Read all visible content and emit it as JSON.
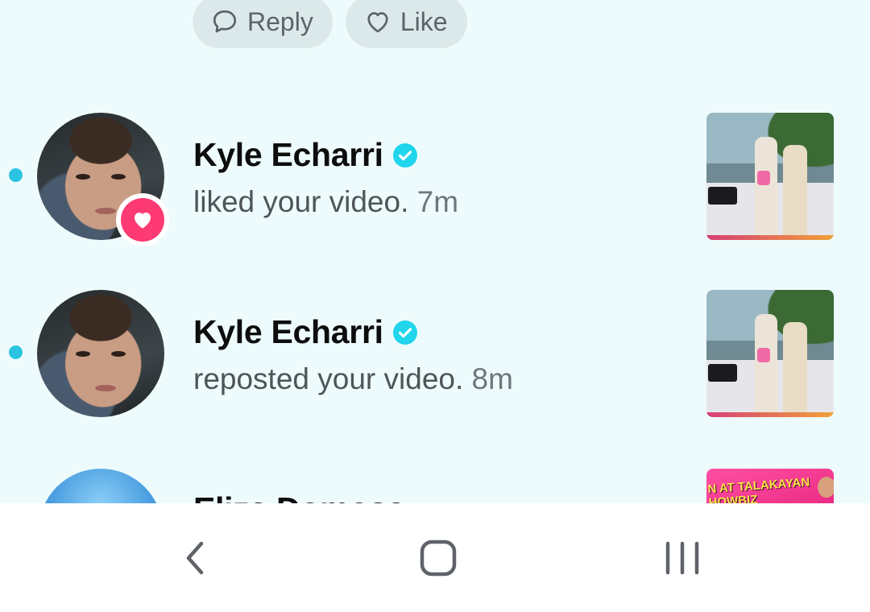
{
  "top_actions": {
    "reply_label": "Reply",
    "like_label": "Like"
  },
  "notifications": [
    {
      "name": "Kyle Echarri",
      "verified": true,
      "action": "liked your video.",
      "time": "7m",
      "unread": true,
      "badge_icon": "heart-icon"
    },
    {
      "name": "Kyle Echarri",
      "verified": true,
      "action": "reposted your video.",
      "time": "8m",
      "unread": true
    },
    {
      "name": "Eliza Domosa",
      "thumbnail_text": "N AT TALAKAYAN HOWBIZ"
    }
  ],
  "nav": {
    "back_icon": "chevron-left-icon",
    "home_icon": "rounded-square-icon",
    "recents_icon": "three-bars-icon"
  },
  "colors": {
    "background": "#eefbfc",
    "unread_dot": "#2cc3e3",
    "like_badge": "#fd3a73",
    "verified": "#20d5ec"
  }
}
